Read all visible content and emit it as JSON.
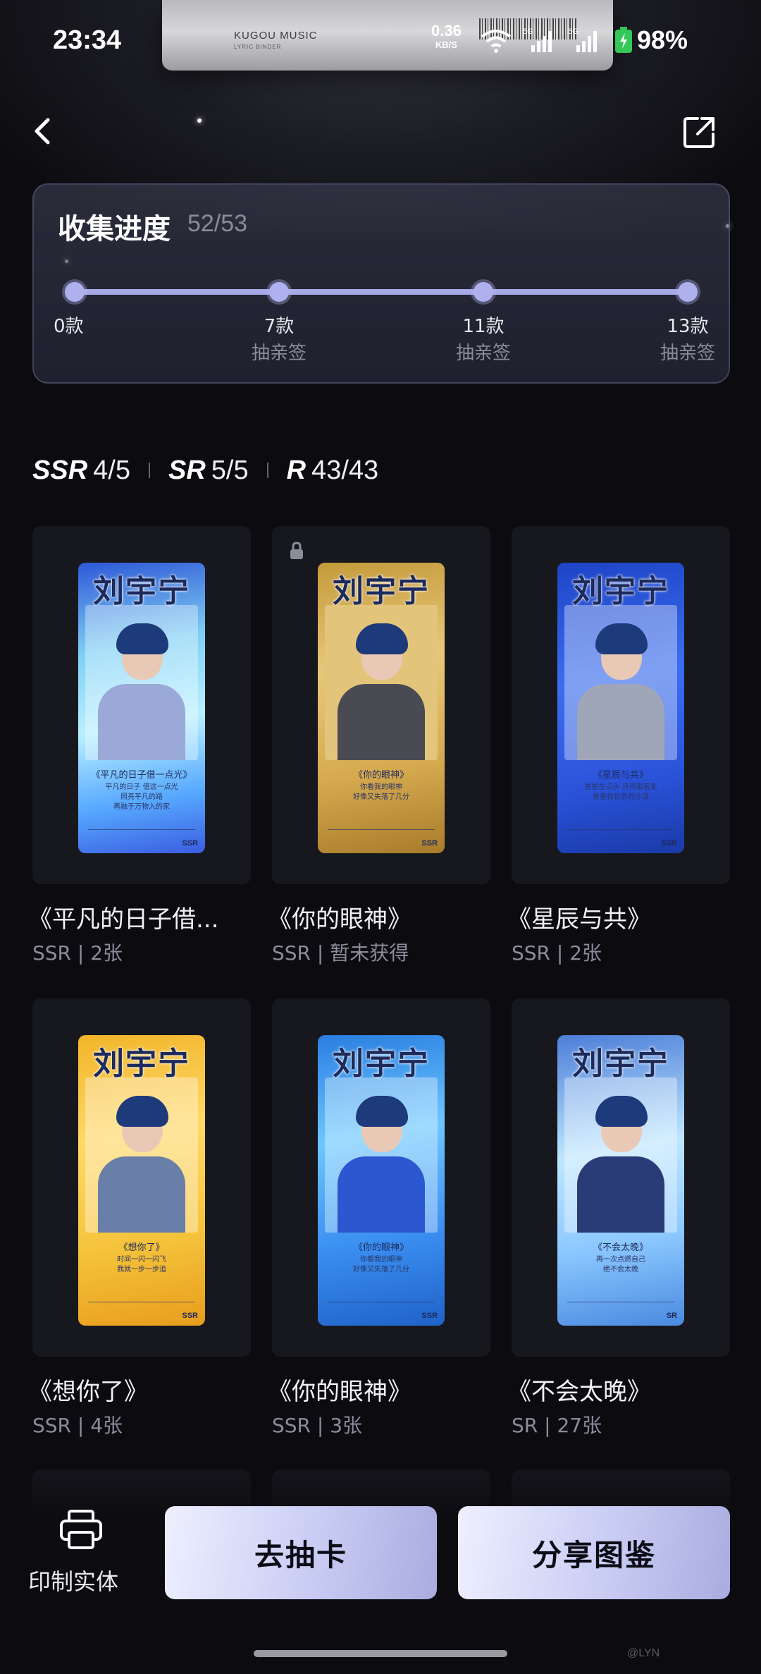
{
  "status_bar": {
    "time": "23:34",
    "net_speed": "0.36",
    "net_speed_unit": "KB/S",
    "network_1": "5G",
    "network_2": "5G",
    "battery": "98%"
  },
  "hero": {
    "brand": "KUGOU MUSIC",
    "brand_sub": "LYRIC BINDER"
  },
  "header": {
    "back_icon": "chevron-left-icon",
    "share_icon": "share-external-icon"
  },
  "progress": {
    "title": "收集进度",
    "count": "52/53",
    "value": 0.98,
    "milestones": [
      {
        "label": "0款",
        "reward": ""
      },
      {
        "label": "7款",
        "reward": "抽亲签"
      },
      {
        "label": "11款",
        "reward": "抽亲签"
      },
      {
        "label": "13款",
        "reward": "抽亲签"
      }
    ]
  },
  "rarity_filter": [
    {
      "tag": "SSR",
      "count": "4/5"
    },
    {
      "tag": "SR",
      "count": "5/5"
    },
    {
      "tag": "R",
      "count": "43/43"
    }
  ],
  "cards": [
    {
      "name": "刘宇宁",
      "title": "《平凡的日子借...",
      "meta": "SSR | 2张",
      "poster_song": "《平凡的日子借一点光》",
      "lyric": [
        "平凡的日子 借这一点光",
        "照亮平凡的路",
        "再融于万物入的家"
      ],
      "rank": "SSR",
      "locked": false,
      "bg": "linear-gradient(170deg,#2e58d6 0%,#7fd0f5 30%,#b8f0ff 55%,#56a8ff 80%,#3b5de0 100%)",
      "shirt": "#9aa9d8"
    },
    {
      "name": "刘宇宁",
      "title": "《你的眼神》",
      "meta": "SSR | 暂未获得",
      "poster_song": "《你的眼神》",
      "lyric": [
        "你看我的眼神",
        "好像又失落了几分"
      ],
      "rank": "SSR",
      "locked": true,
      "bg": "linear-gradient(170deg,#c49a3a 0%,#e8c77a 35%,#d6aa4f 70%,#a87c2a 100%)",
      "shirt": "#4a4a52"
    },
    {
      "name": "刘宇宁",
      "title": "《星辰与共》",
      "meta": "SSR | 2张",
      "poster_song": "《星辰与共》",
      "lyric": [
        "星星在点头 月亮跟着走",
        "星星在世界的沙漠"
      ],
      "rank": "SSR",
      "locked": false,
      "bg": "linear-gradient(170deg,#1e44c6 0%,#3b6ef0 40%,#2a52d8 75%,#1a3aa8 100%)",
      "shirt": "#9ea6b8"
    },
    {
      "name": "刘宇宁",
      "title": "《想你了》",
      "meta": "SSR | 4张",
      "poster_song": "《想你了》",
      "lyric": [
        "时间一闪一闪飞",
        "我就一步一步追"
      ],
      "rank": "SSR",
      "locked": false,
      "bg": "linear-gradient(170deg,#f2b52a 0%,#ffd867 35%,#f5c33b 70%,#e89d1c 100%)",
      "shirt": "#6a7fa8"
    },
    {
      "name": "刘宇宁",
      "title": "《你的眼神》",
      "meta": "SSR | 3张",
      "poster_song": "《你的眼神》",
      "lyric": [
        "你看我的眼神",
        "好像又失落了几分"
      ],
      "rank": "SSR",
      "locked": false,
      "bg": "linear-gradient(170deg,#2a7de0 0%,#6cc7ff 35%,#3a8ef0 70%,#2062c8 100%)",
      "shirt": "#2b58d0"
    },
    {
      "name": "刘宇宁",
      "title": "《不会太晚》",
      "meta": "SR | 27张",
      "poster_song": "《不会太晚》",
      "lyric": [
        "再一次点燃自己",
        "绝不会太晚"
      ],
      "rank": "SR",
      "locked": false,
      "bg": "linear-gradient(170deg,#4c7ed8 0%,#bfe6ff 40%,#8cc8ff 70%,#4a8ae0 100%)",
      "shirt": "#2a3c78"
    }
  ],
  "bottom_bar": {
    "print_label": "印制实体",
    "draw_label": "去抽卡",
    "share_label": "分享图鉴"
  },
  "watermark": "@LYN"
}
